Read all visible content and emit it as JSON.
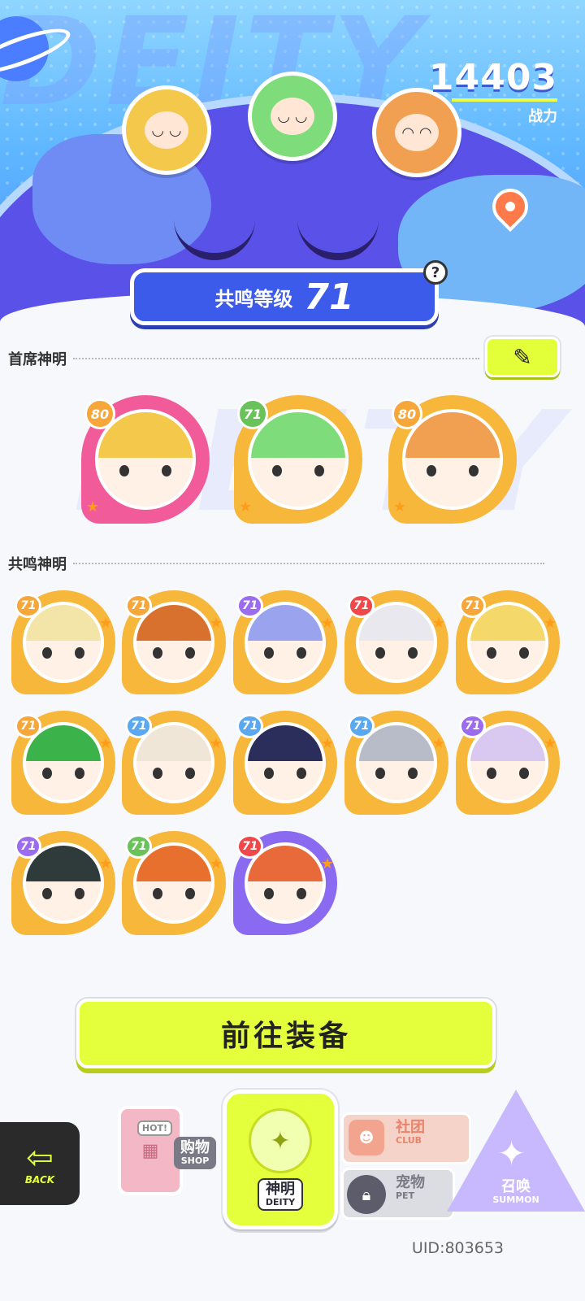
{
  "header": {
    "bg_word": "DEITY",
    "power_value": "14403",
    "power_label": "战力",
    "resonance_label": "共鸣等级",
    "resonance_level": "71",
    "help_glyph": "?"
  },
  "sections": {
    "primary_title": "首席神明",
    "resonance_title": "共鸣神明",
    "edit_icon": "pencil-icon"
  },
  "primary_deities": [
    {
      "level": "80",
      "frame": "#f25b9a",
      "badge": "#f7a63a",
      "hair": "#f4c84a"
    },
    {
      "level": "71",
      "frame": "#f7b73a",
      "badge": "#6ac35a",
      "hair": "#7fdc7a"
    },
    {
      "level": "80",
      "frame": "#f7b73a",
      "badge": "#f7a63a",
      "hair": "#f0a050"
    }
  ],
  "resonance_deities": [
    {
      "level": "71",
      "badge": "#f7a63a",
      "frame": "#f7b73a",
      "hair": "#f3e4a8"
    },
    {
      "level": "71",
      "badge": "#f7a63a",
      "frame": "#f7b73a",
      "hair": "#d8702e"
    },
    {
      "level": "71",
      "badge": "#9b6bf0",
      "frame": "#f7b73a",
      "hair": "#9aa3ee"
    },
    {
      "level": "71",
      "badge": "#f0474a",
      "frame": "#f7b73a",
      "hair": "#e8e8ee"
    },
    {
      "level": "71",
      "badge": "#f7a63a",
      "frame": "#f7b73a",
      "hair": "#f4d96a"
    },
    {
      "level": "71",
      "badge": "#f7a63a",
      "frame": "#f7b73a",
      "hair": "#3bb24a"
    },
    {
      "level": "71",
      "badge": "#5aa9f0",
      "frame": "#f7b73a",
      "hair": "#f0e6d8"
    },
    {
      "level": "71",
      "badge": "#5aa9f0",
      "frame": "#f7b73a",
      "hair": "#2b2e5a"
    },
    {
      "level": "71",
      "badge": "#5aa9f0",
      "frame": "#f7b73a",
      "hair": "#b8bcc8"
    },
    {
      "level": "71",
      "badge": "#9b6bf0",
      "frame": "#f7b73a",
      "hair": "#d9c8f0"
    },
    {
      "level": "71",
      "badge": "#9b6bf0",
      "frame": "#f7b73a",
      "hair": "#2f3a3a"
    },
    {
      "level": "71",
      "badge": "#6ac35a",
      "frame": "#f7b73a",
      "hair": "#e7702e"
    },
    {
      "level": "71",
      "badge": "#f0474a",
      "frame": "#8a6af0",
      "hair": "#e86a3a"
    }
  ],
  "equip_button": "前往装备",
  "nav": {
    "back": "BACK",
    "shop_hot": "HOT!",
    "shop_cn": "购物",
    "shop_en": "SHOP",
    "deity_cn": "神明",
    "deity_en": "DEITY",
    "club_cn": "社团",
    "club_en": "CLUB",
    "pet_cn": "宠物",
    "pet_en": "PET",
    "summon_cn": "召唤",
    "summon_en": "SUMMON"
  },
  "uid": "UID:803653"
}
